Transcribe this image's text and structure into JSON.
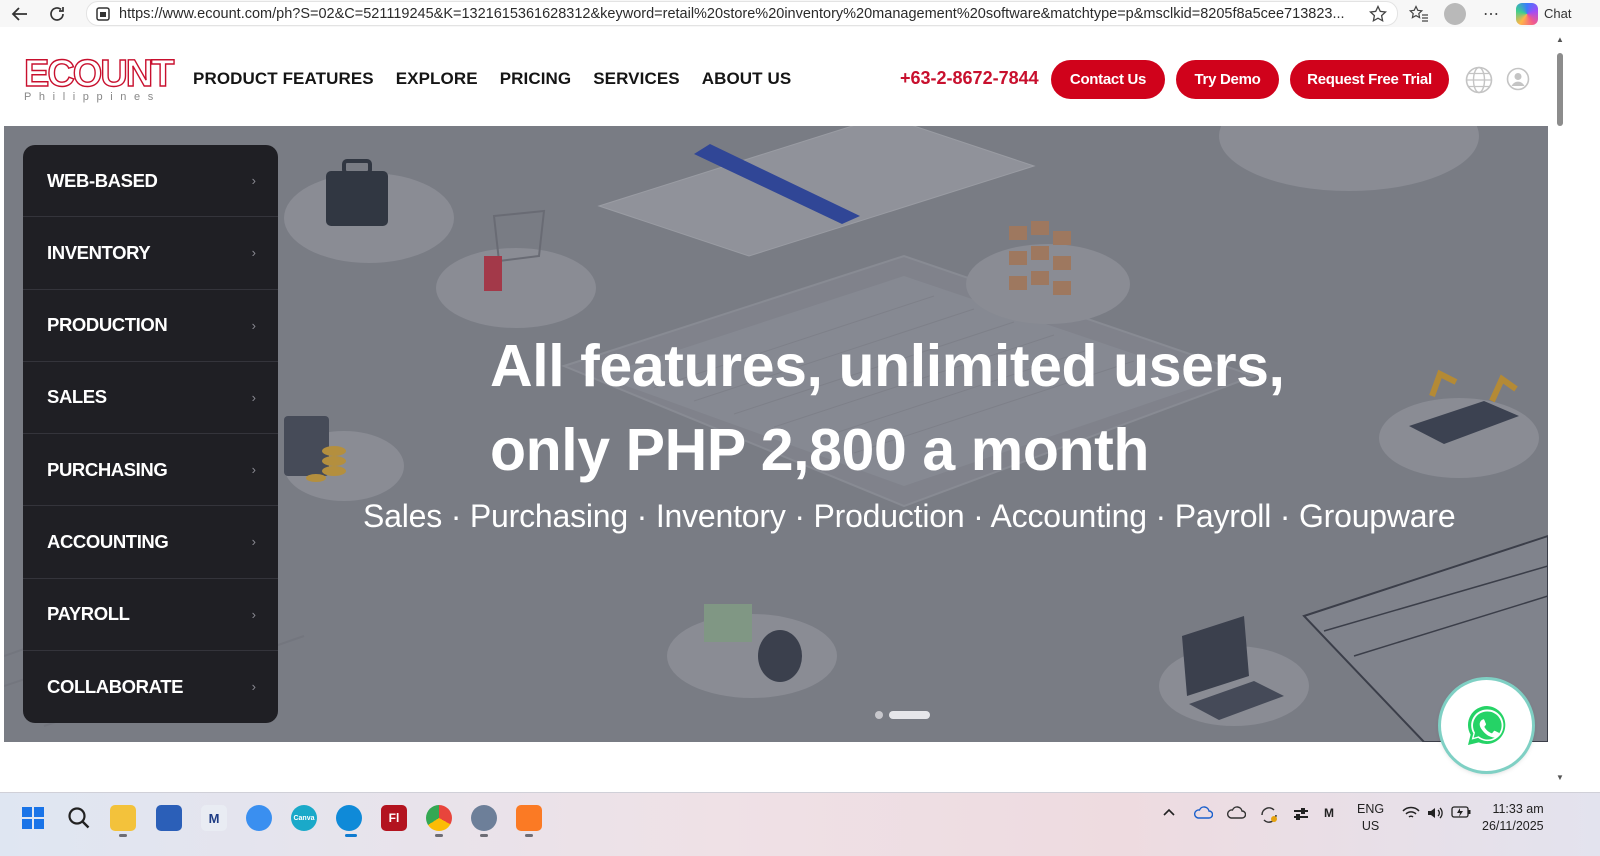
{
  "browser": {
    "url": "https://www.ecount.com/ph?S=02&C=521119245&K=1321615361628312&keyword=retail%20store%20inventory%20management%20software&matchtype=p&msclkid=8205f8a5cee713823...",
    "chat_label": "Chat"
  },
  "header": {
    "logo_text": "ECOUNT",
    "logo_sub": "Philippines",
    "nav": [
      "PRODUCT FEATURES",
      "EXPLORE",
      "PRICING",
      "SERVICES",
      "ABOUT US"
    ],
    "phone": "+63-2-8672-7844",
    "contact_label": "Contact Us",
    "demo_label": "Try Demo",
    "trial_label": "Request Free Trial"
  },
  "side_menu": [
    "WEB-BASED",
    "INVENTORY",
    "PRODUCTION",
    "SALES",
    "PURCHASING",
    "ACCOUNTING",
    "PAYROLL",
    "COLLABORATE"
  ],
  "hero": {
    "headline_line1": "All features, unlimited users,",
    "headline_line2": "only PHP 2,800 a month",
    "subline": "Sales · Purchasing · Inventory · Production · Accounting · Payroll · Groupware",
    "slide_count": 2,
    "active_slide": 2
  },
  "taskbar": {
    "apps": [
      "start-icon",
      "search-icon",
      "file-explorer-icon",
      "store-icon",
      "mail-icon",
      "cloud-icon",
      "canva-icon",
      "edge-icon",
      "flash-icon",
      "chrome-icon",
      "settings-icon",
      "xampp-icon"
    ],
    "lang_line1": "ENG",
    "lang_line2": "US",
    "time": "11:33 am",
    "date": "26/11/2025"
  },
  "colors": {
    "brand_red": "#d0021b",
    "menu_dark": "#1f1f24"
  }
}
